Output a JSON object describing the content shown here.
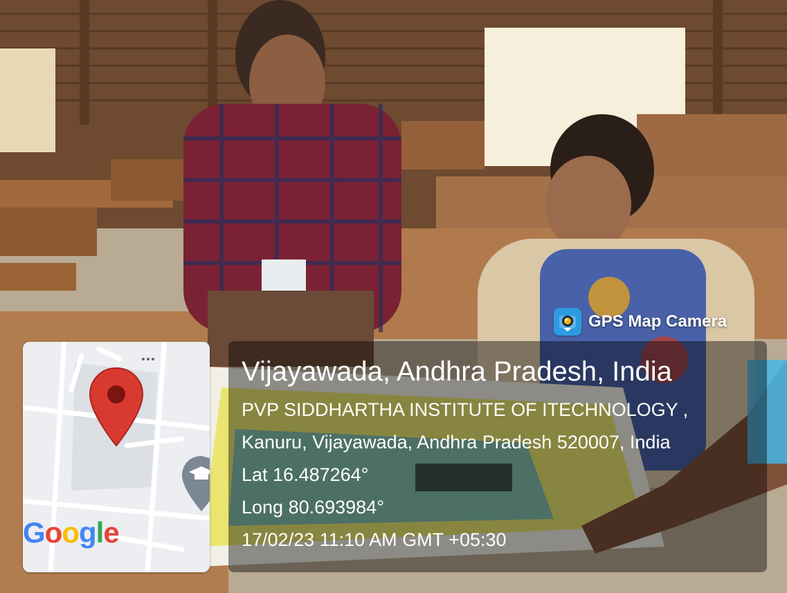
{
  "badge": {
    "label": "GPS Map Camera",
    "icon": "gps-map-camera-icon",
    "icon_color": "#2d9be0"
  },
  "map": {
    "pin_icon": "location-pin-icon",
    "pin_color": "#d93a30",
    "place_icon": "graduation-cap-icon",
    "menu_icon": "more-dots-icon",
    "logo_letters": [
      {
        "char": "G",
        "color": "#4285F4"
      },
      {
        "char": "o",
        "color": "#EA4335"
      },
      {
        "char": "o",
        "color": "#FBBC05"
      },
      {
        "char": "g",
        "color": "#4285F4"
      },
      {
        "char": "l",
        "color": "#34A853"
      },
      {
        "char": "e",
        "color": "#EA4335"
      }
    ]
  },
  "info": {
    "title": "Vijayawada, Andhra Pradesh, India",
    "address_line1": "PVP SIDDHARTHA INSTITUTE OF ITECHNOLOGY ,",
    "address_line2": "Kanuru, Vijayawada, Andhra Pradesh 520007, India",
    "lat": "Lat 16.487264°",
    "long": "Long 80.693984°",
    "datetime": "17/02/23 11:10 AM GMT +05:30"
  }
}
